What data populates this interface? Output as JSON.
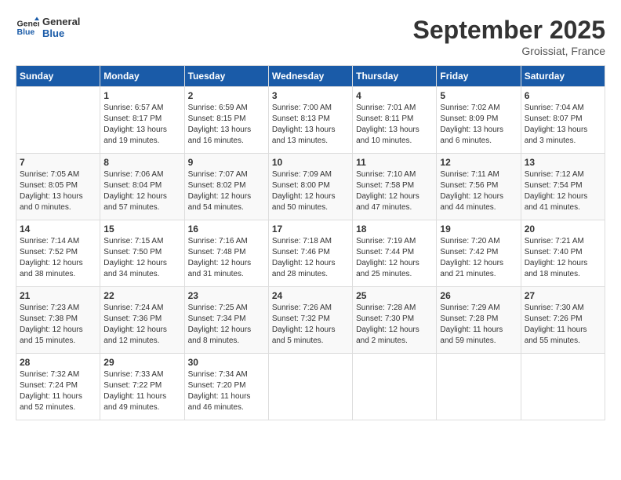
{
  "header": {
    "logo_line1": "General",
    "logo_line2": "Blue",
    "month_title": "September 2025",
    "location": "Groissiat, France"
  },
  "columns": [
    "Sunday",
    "Monday",
    "Tuesday",
    "Wednesday",
    "Thursday",
    "Friday",
    "Saturday"
  ],
  "weeks": [
    [
      {
        "day": "",
        "content": ""
      },
      {
        "day": "1",
        "content": "Sunrise: 6:57 AM\nSunset: 8:17 PM\nDaylight: 13 hours\nand 19 minutes."
      },
      {
        "day": "2",
        "content": "Sunrise: 6:59 AM\nSunset: 8:15 PM\nDaylight: 13 hours\nand 16 minutes."
      },
      {
        "day": "3",
        "content": "Sunrise: 7:00 AM\nSunset: 8:13 PM\nDaylight: 13 hours\nand 13 minutes."
      },
      {
        "day": "4",
        "content": "Sunrise: 7:01 AM\nSunset: 8:11 PM\nDaylight: 13 hours\nand 10 minutes."
      },
      {
        "day": "5",
        "content": "Sunrise: 7:02 AM\nSunset: 8:09 PM\nDaylight: 13 hours\nand 6 minutes."
      },
      {
        "day": "6",
        "content": "Sunrise: 7:04 AM\nSunset: 8:07 PM\nDaylight: 13 hours\nand 3 minutes."
      }
    ],
    [
      {
        "day": "7",
        "content": "Sunrise: 7:05 AM\nSunset: 8:05 PM\nDaylight: 13 hours\nand 0 minutes."
      },
      {
        "day": "8",
        "content": "Sunrise: 7:06 AM\nSunset: 8:04 PM\nDaylight: 12 hours\nand 57 minutes."
      },
      {
        "day": "9",
        "content": "Sunrise: 7:07 AM\nSunset: 8:02 PM\nDaylight: 12 hours\nand 54 minutes."
      },
      {
        "day": "10",
        "content": "Sunrise: 7:09 AM\nSunset: 8:00 PM\nDaylight: 12 hours\nand 50 minutes."
      },
      {
        "day": "11",
        "content": "Sunrise: 7:10 AM\nSunset: 7:58 PM\nDaylight: 12 hours\nand 47 minutes."
      },
      {
        "day": "12",
        "content": "Sunrise: 7:11 AM\nSunset: 7:56 PM\nDaylight: 12 hours\nand 44 minutes."
      },
      {
        "day": "13",
        "content": "Sunrise: 7:12 AM\nSunset: 7:54 PM\nDaylight: 12 hours\nand 41 minutes."
      }
    ],
    [
      {
        "day": "14",
        "content": "Sunrise: 7:14 AM\nSunset: 7:52 PM\nDaylight: 12 hours\nand 38 minutes."
      },
      {
        "day": "15",
        "content": "Sunrise: 7:15 AM\nSunset: 7:50 PM\nDaylight: 12 hours\nand 34 minutes."
      },
      {
        "day": "16",
        "content": "Sunrise: 7:16 AM\nSunset: 7:48 PM\nDaylight: 12 hours\nand 31 minutes."
      },
      {
        "day": "17",
        "content": "Sunrise: 7:18 AM\nSunset: 7:46 PM\nDaylight: 12 hours\nand 28 minutes."
      },
      {
        "day": "18",
        "content": "Sunrise: 7:19 AM\nSunset: 7:44 PM\nDaylight: 12 hours\nand 25 minutes."
      },
      {
        "day": "19",
        "content": "Sunrise: 7:20 AM\nSunset: 7:42 PM\nDaylight: 12 hours\nand 21 minutes."
      },
      {
        "day": "20",
        "content": "Sunrise: 7:21 AM\nSunset: 7:40 PM\nDaylight: 12 hours\nand 18 minutes."
      }
    ],
    [
      {
        "day": "21",
        "content": "Sunrise: 7:23 AM\nSunset: 7:38 PM\nDaylight: 12 hours\nand 15 minutes."
      },
      {
        "day": "22",
        "content": "Sunrise: 7:24 AM\nSunset: 7:36 PM\nDaylight: 12 hours\nand 12 minutes."
      },
      {
        "day": "23",
        "content": "Sunrise: 7:25 AM\nSunset: 7:34 PM\nDaylight: 12 hours\nand 8 minutes."
      },
      {
        "day": "24",
        "content": "Sunrise: 7:26 AM\nSunset: 7:32 PM\nDaylight: 12 hours\nand 5 minutes."
      },
      {
        "day": "25",
        "content": "Sunrise: 7:28 AM\nSunset: 7:30 PM\nDaylight: 12 hours\nand 2 minutes."
      },
      {
        "day": "26",
        "content": "Sunrise: 7:29 AM\nSunset: 7:28 PM\nDaylight: 11 hours\nand 59 minutes."
      },
      {
        "day": "27",
        "content": "Sunrise: 7:30 AM\nSunset: 7:26 PM\nDaylight: 11 hours\nand 55 minutes."
      }
    ],
    [
      {
        "day": "28",
        "content": "Sunrise: 7:32 AM\nSunset: 7:24 PM\nDaylight: 11 hours\nand 52 minutes."
      },
      {
        "day": "29",
        "content": "Sunrise: 7:33 AM\nSunset: 7:22 PM\nDaylight: 11 hours\nand 49 minutes."
      },
      {
        "day": "30",
        "content": "Sunrise: 7:34 AM\nSunset: 7:20 PM\nDaylight: 11 hours\nand 46 minutes."
      },
      {
        "day": "",
        "content": ""
      },
      {
        "day": "",
        "content": ""
      },
      {
        "day": "",
        "content": ""
      },
      {
        "day": "",
        "content": ""
      }
    ]
  ]
}
